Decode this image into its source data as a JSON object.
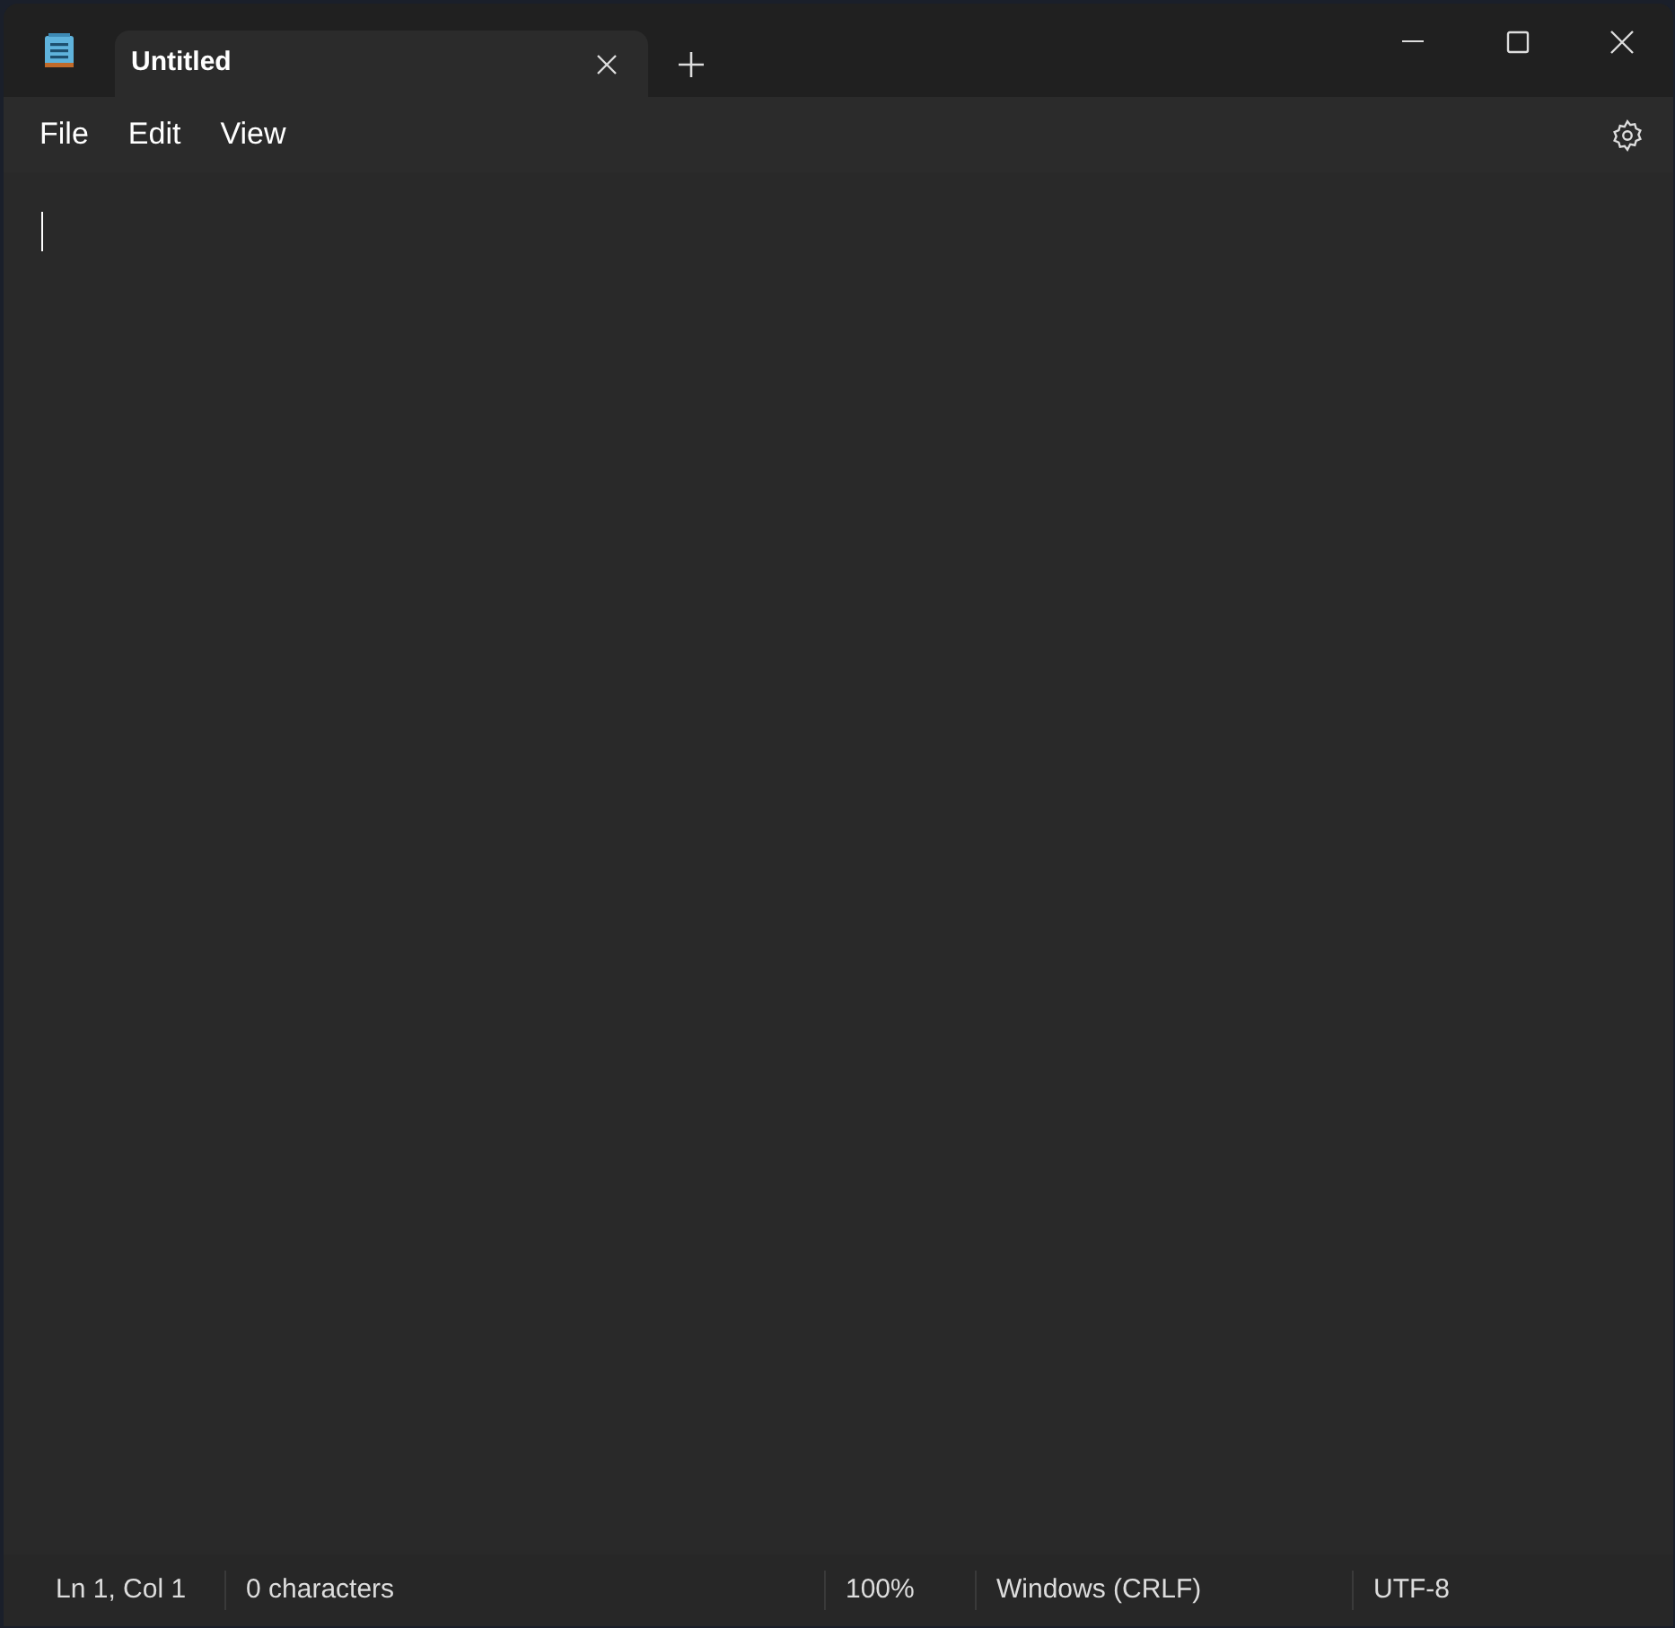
{
  "tabs": [
    {
      "title": "Untitled",
      "selected": true
    }
  ],
  "menu": [
    "File",
    "Edit",
    "View"
  ],
  "status_bar": [
    {
      "kind": "position",
      "text": "Ln 1, Col 1"
    },
    {
      "kind": "count",
      "text": "0 characters"
    },
    {
      "kind": "zoom",
      "text": "100%"
    },
    {
      "kind": "line_ending",
      "text": "Windows (CRLF)"
    },
    {
      "kind": "encoding",
      "text": "UTF-8"
    }
  ]
}
